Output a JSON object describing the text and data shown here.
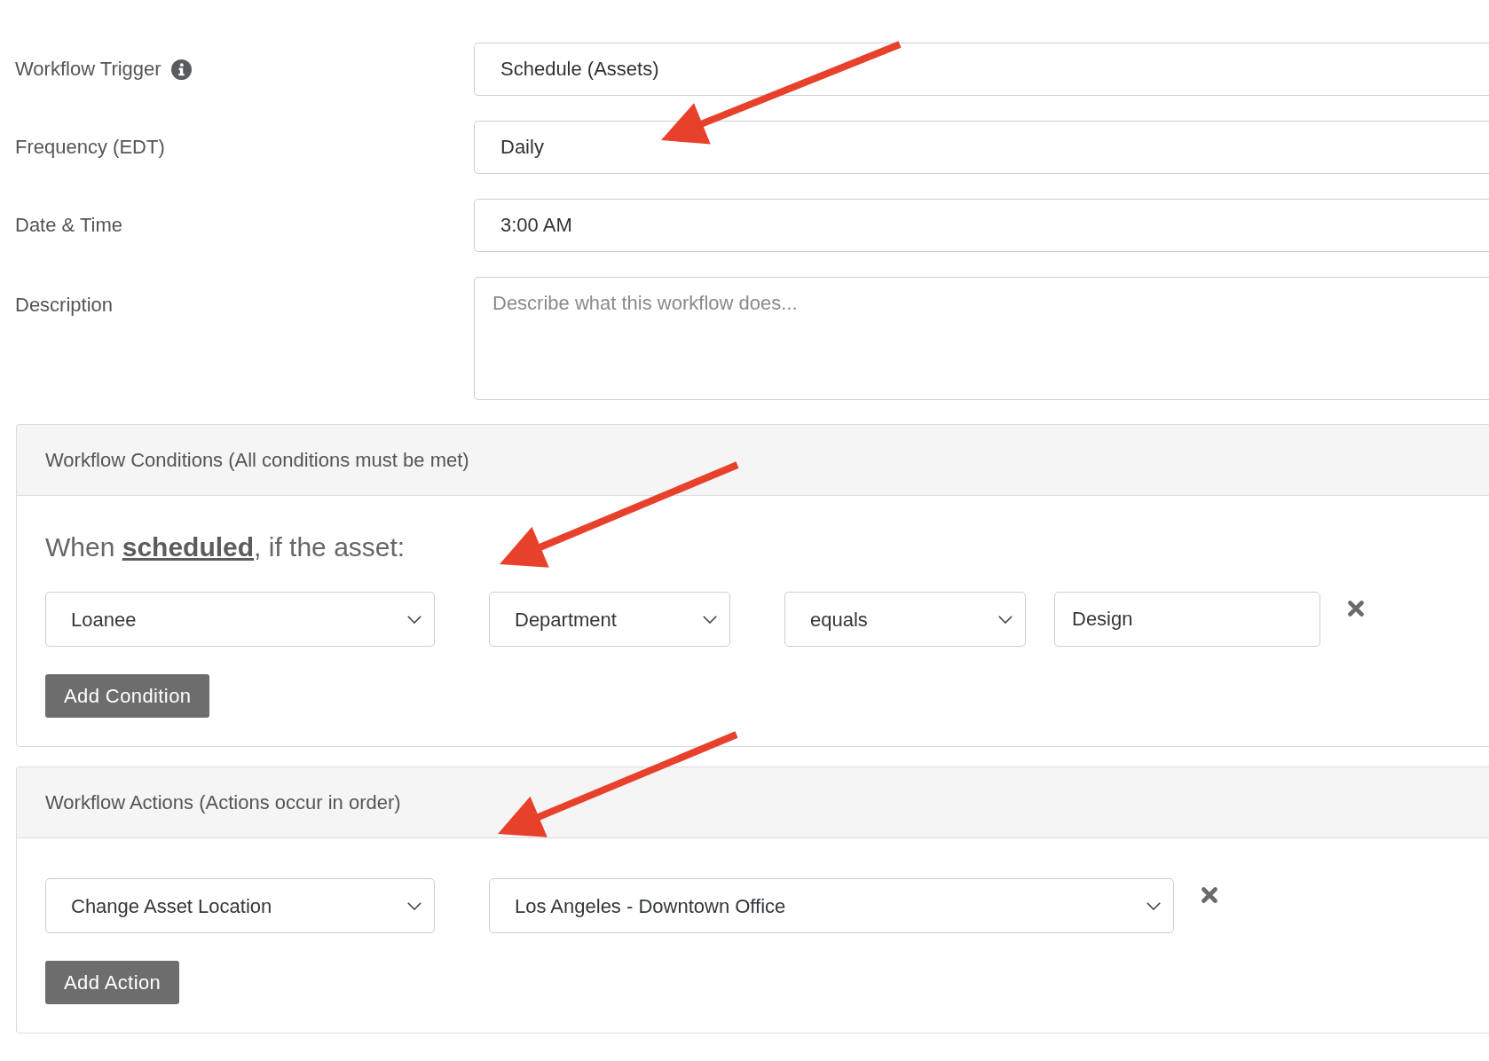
{
  "form_fields": [
    {
      "label": "Workflow Trigger",
      "info_icon": true,
      "kind": "input",
      "value": "Schedule (Assets)"
    },
    {
      "label": "Frequency (EDT)",
      "kind": "input",
      "value": "Daily"
    },
    {
      "label": "Date & Time",
      "kind": "input",
      "value": "3:00 AM"
    },
    {
      "label": "Description",
      "kind": "textarea",
      "placeholder": "Describe what this workflow does..."
    }
  ],
  "panels": [
    {
      "kind": "conditions",
      "title": "Workflow Conditions (All conditions must be met)",
      "intro": "When **scheduled**, if the asset:",
      "rows": [
        {
          "fields": [
            {
              "kind": "select",
              "value": "Loanee"
            },
            {
              "kind": "select",
              "value": "Department"
            },
            {
              "kind": "select",
              "value": "equals"
            },
            {
              "kind": "input",
              "value": "Design"
            }
          ]
        }
      ],
      "add_button": "Add Condition"
    },
    {
      "kind": "actions",
      "title": "Workflow Actions (Actions occur in order)",
      "rows": [
        {
          "fields": [
            {
              "kind": "select",
              "value": "Change Asset Location"
            },
            {
              "kind": "select",
              "value": "Los Angeles - Downtown Office"
            }
          ]
        }
      ],
      "add_button": "Add Action"
    }
  ]
}
